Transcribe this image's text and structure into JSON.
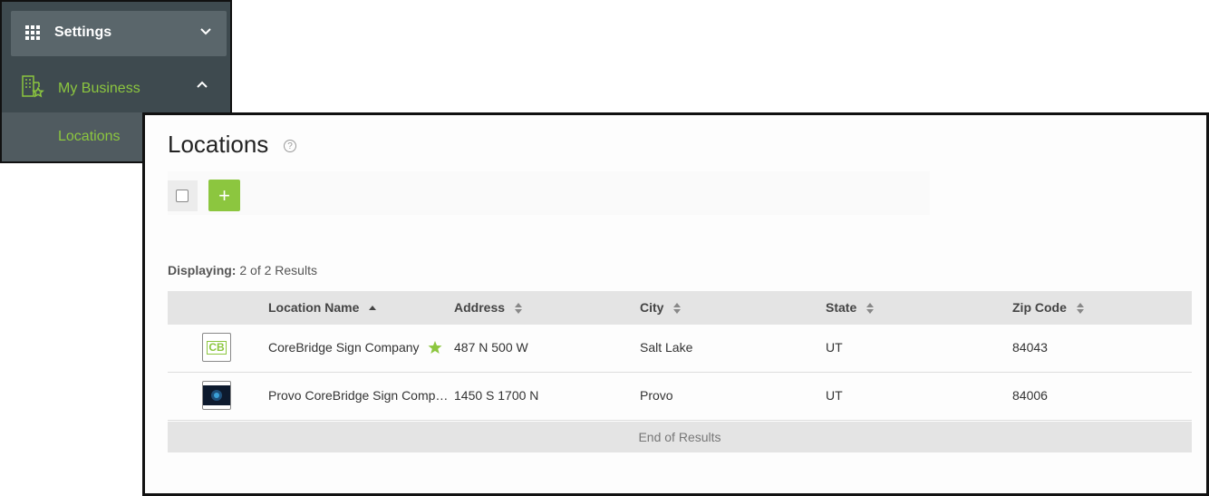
{
  "sidebar": {
    "settings_label": "Settings",
    "business_label": "My Business",
    "locations_label": "Locations"
  },
  "page": {
    "title": "Locations",
    "help": "?",
    "add_symbol": "+",
    "displaying_label": "Displaying:",
    "displaying_value": "2 of 2 Results",
    "end_of_results": "End of Results"
  },
  "table": {
    "headers": [
      "Location Name",
      "Address",
      "City",
      "State",
      "Zip Code"
    ],
    "rows": [
      {
        "name": "CoreBridge Sign Company",
        "address": "487 N 500 W",
        "city": "Salt Lake",
        "state": "UT",
        "zip": "84043",
        "logo_text": "CB",
        "primary": true
      },
      {
        "name": "Provo CoreBridge Sign Comp…",
        "address": "1450 S 1700 N",
        "city": "Provo",
        "state": "UT",
        "zip": "84006",
        "logo_text": "",
        "primary": false
      }
    ]
  },
  "colors": {
    "accent": "#8cc63f",
    "sidebar_bg": "#3e4a4f",
    "header_bg": "#e4e4e4"
  }
}
